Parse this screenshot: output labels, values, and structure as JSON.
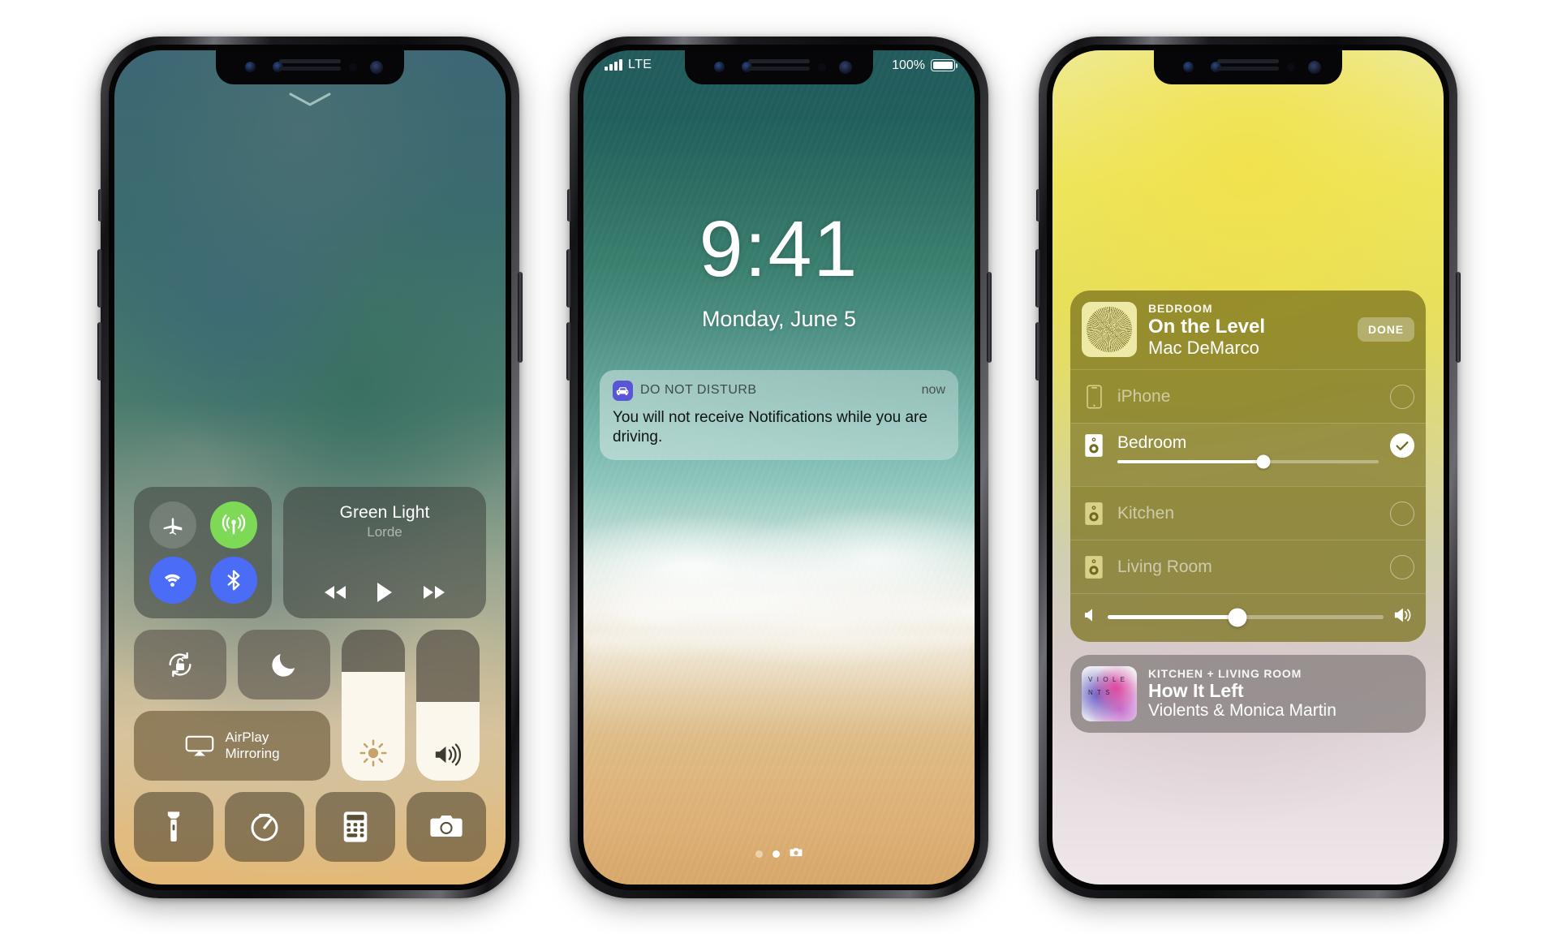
{
  "phone1": {
    "name": "control-center",
    "chevron_icon": "chevron-down-icon",
    "toggles": [
      {
        "name": "airplane-mode",
        "icon": "airplane-icon",
        "state": "off"
      },
      {
        "name": "cellular-data",
        "icon": "cellular-antenna-icon",
        "state": "on",
        "color": "#7ed957"
      },
      {
        "name": "wifi",
        "icon": "wifi-icon",
        "state": "on",
        "color": "#4a6cf7"
      },
      {
        "name": "bluetooth",
        "icon": "bluetooth-icon",
        "state": "on",
        "color": "#4a6cf7"
      }
    ],
    "media": {
      "title": "Green Light",
      "artist": "Lorde",
      "prev_icon": "rewind-icon",
      "play_icon": "play-icon",
      "next_icon": "fast-forward-icon"
    },
    "tiles": [
      {
        "name": "rotation-lock",
        "icon": "rotation-lock-icon"
      },
      {
        "name": "do-not-disturb",
        "icon": "moon-icon"
      }
    ],
    "airplay_mirroring": {
      "label_line1": "AirPlay",
      "label_line2": "Mirroring",
      "icon": "airplay-icon"
    },
    "brightness": {
      "name": "brightness-slider",
      "icon": "brightness-icon",
      "value": 72
    },
    "volume": {
      "name": "volume-slider",
      "icon": "speaker-wave-icon",
      "value": 52
    },
    "apps": [
      {
        "name": "flashlight",
        "icon": "flashlight-icon"
      },
      {
        "name": "timer",
        "icon": "timer-icon"
      },
      {
        "name": "calculator",
        "icon": "calculator-icon"
      },
      {
        "name": "camera",
        "icon": "camera-icon"
      }
    ]
  },
  "phone2": {
    "name": "lock-screen",
    "statusbar": {
      "signal_icon": "signal-bars-icon",
      "carrier": "LTE",
      "battery_percent": "100%",
      "battery_icon": "battery-full-icon"
    },
    "time": "9:41",
    "date": "Monday, June 5",
    "notification": {
      "app_icon": "car-icon",
      "app_name": "DO NOT DISTURB",
      "time": "now",
      "body": "You will not receive Notifications while you are driving."
    },
    "page_dots": {
      "count": 2,
      "active_index": 1,
      "camera_icon": "camera-icon"
    }
  },
  "phone3": {
    "name": "airplay-picker",
    "now_playing": {
      "room": "BEDROOM",
      "track": "On the Level",
      "artist": "Mac DeMarco",
      "done_label": "DONE",
      "artwork_name": "album-art-on-the-level"
    },
    "devices": [
      {
        "name": "iPhone",
        "icon": "iphone-icon",
        "selected": false
      },
      {
        "name": "Bedroom",
        "icon": "speaker-icon",
        "selected": true,
        "volume": 56
      },
      {
        "name": "Kitchen",
        "icon": "speaker-icon",
        "selected": false
      },
      {
        "name": "Living Room",
        "icon": "speaker-icon",
        "selected": false
      }
    ],
    "master_volume": {
      "value": 47,
      "low_icon": "speaker-low-icon",
      "high_icon": "speaker-wave-icon"
    },
    "second_card": {
      "room": "KITCHEN + LIVING ROOM",
      "track": "How It Left",
      "artist": "Violents & Monica Martin",
      "artwork_name": "album-art-how-it-left",
      "artwork_text": "V I O  L E N  T S"
    }
  },
  "colors": {
    "accent_green": "#7ed957",
    "accent_blue": "#4a6cf7",
    "notif_app_badge": "#5856d6",
    "airplay_card": "#7a721e"
  }
}
